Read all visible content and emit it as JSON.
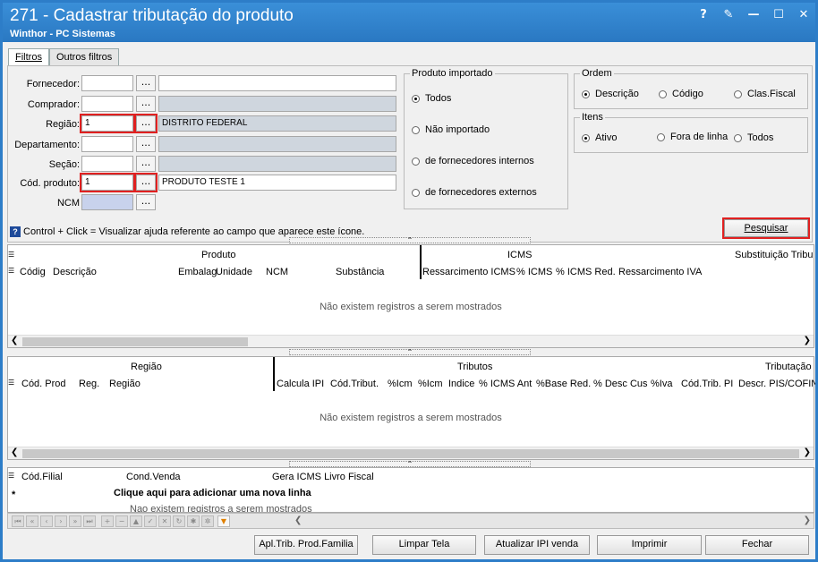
{
  "window": {
    "title": "271 - Cadastrar tributação do produto",
    "subtitle": "Winthor - PC Sistemas",
    "btn_help": "?",
    "btn_edit": "✎",
    "btn_min": "—",
    "btn_max": "☐",
    "btn_close": "✕"
  },
  "tabs": [
    "Filtros",
    "Outros filtros"
  ],
  "filters": {
    "fornecedor_label": "Fornecedor:",
    "comprador_label": "Comprador:",
    "regiao_label": "Região:",
    "departamento_label": "Departamento:",
    "secao_label": "Seção:",
    "cod_produto_label": "Cód. produto:",
    "ncm_label": "NCM",
    "regiao_value": "1",
    "regiao_desc": "DISTRITO FEDERAL",
    "cod_produto_value": "1",
    "cod_produto_desc": "PRODUTO TESTE 1",
    "dots": "..."
  },
  "produto_importado": {
    "title": "Produto importado",
    "options": [
      "Todos",
      "Não importado",
      "de fornecedores internos",
      "de fornecedores externos"
    ]
  },
  "ordem": {
    "title": "Ordem",
    "options": [
      "Descrição",
      "Código",
      "Clas.Fiscal"
    ]
  },
  "itens": {
    "title": "Itens",
    "options": [
      "Ativo",
      "Fora de linha",
      "Todos"
    ]
  },
  "pesquisar": "Pesquisar",
  "help_text": "Control + Click = Visualizar ajuda referente ao campo que aparece este ícone.",
  "help_icon": "?",
  "grid1": {
    "bands": [
      "Produto",
      "ICMS",
      "Substituição Tribu"
    ],
    "cols": [
      "Códig",
      "Descrição",
      "Embalag",
      "Unidade",
      "NCM",
      "Substância",
      "Ressarcimento ICMS",
      "% ICMS",
      "% ICMS Red.",
      "Ressarcimento IVA"
    ],
    "empty": "Não existem registros a serem mostrados"
  },
  "grid2": {
    "bands": [
      "Região",
      "Tributos",
      "Tributação"
    ],
    "cols": [
      "Cód. Prod",
      "Reg.",
      "Região",
      "Calcula IPI",
      "Cód.Tribut.",
      "%Icm",
      "%Icm",
      "Indice",
      "% ICMS Ant",
      "%Base Red.",
      "% Desc Cus",
      "%Iva",
      "Cód.Trib. PI",
      "Descr. PIS/COFIN"
    ],
    "empty": "Não existem registros a serem mostrados"
  },
  "grid3": {
    "cols": [
      "Cód.Filial",
      "Cond.Venda",
      "Gera ICMS Livro Fiscal"
    ],
    "add_row": "Clique aqui para adicionar uma nova linha",
    "empty": "Nao existem registros a serem mostrados",
    "star": "*"
  },
  "buttons": {
    "apl": "Apl.Trib. Prod.Familia",
    "limpar": "Limpar Tela",
    "atualizar": "Atualizar IPI venda",
    "imprimir": "Imprimir",
    "fechar": "Fechar"
  }
}
